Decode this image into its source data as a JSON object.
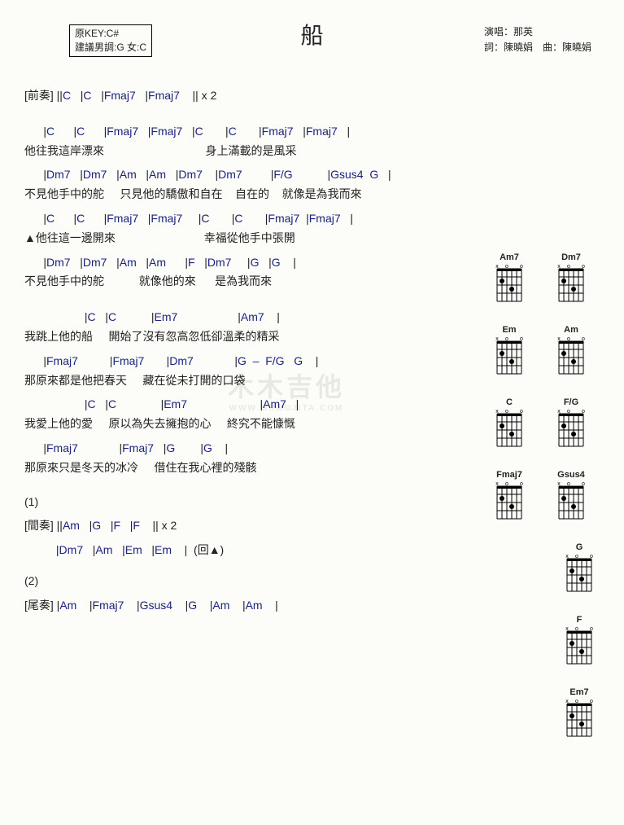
{
  "header": {
    "title": "船",
    "key_line1": "原KEY:C#",
    "key_line2": "建議男調:G 女:C",
    "credit_singer": "演唱：那英",
    "credit_writer": "詞：陳曉娟　曲：陳曉娟"
  },
  "section_labels": {
    "intro": "[前奏] ",
    "inter": "[間奏] ",
    "outro": "[尾奏] ",
    "one": "(1)",
    "two": "(2)",
    "da": "(回▲)"
  },
  "intro": {
    "chords": [
      "C",
      "C",
      "Fmaj7",
      "Fmaj7"
    ],
    "tail": "|| x 2"
  },
  "verse1": {
    "l1_chords": [
      "C",
      "C",
      "Fmaj7",
      "Fmaj7",
      "C",
      "C",
      "Fmaj7",
      "Fmaj7"
    ],
    "l1_lyrics": "他往我這岸漂來                                身上滿載的是風采",
    "l2_chords": [
      "Dm7",
      "Dm7",
      "Am",
      "Am",
      "Dm7",
      "Dm7",
      "F/G",
      "Gsus4  G"
    ],
    "l2_lyrics": "不見他手中的舵     只見他的驕傲和自在    自在的    就像是為我而來",
    "l3_chords": [
      "C",
      "C",
      "Fmaj7",
      "Fmaj7",
      "C",
      "C",
      "Fmaj7",
      "Fmaj7"
    ],
    "l3_lyrics": "▲他往這一邊開來                            幸福從他手中張開",
    "l4_chords": [
      "Dm7",
      "Dm7",
      "Am",
      "Am",
      "F",
      "Dm7",
      "G",
      "G"
    ],
    "l4_lyrics": "不見他手中的舵           就像他的來      是為我而來"
  },
  "chorus": {
    "l1_chords": [
      "C",
      "C",
      "Em7",
      "Am7"
    ],
    "l1_lyrics": "我跳上他的船     開始了沒有忽高忽低卻溫柔的精采",
    "l2_chords": [
      "Fmaj7",
      "Fmaj7",
      "Dm7",
      "G  –  F/G   G"
    ],
    "l2_lyrics": "那原來都是他把春天     藏在從未打開的口袋",
    "l3_chords": [
      "C",
      "C",
      "Em7",
      "Am7"
    ],
    "l3_lyrics": "我愛上他的愛     原以為失去擁抱的心     終究不能慷慨",
    "l4_chords": [
      "Fmaj7",
      "Fmaj7",
      "G",
      "G"
    ],
    "l4_lyrics": "那原來只是冬天的冰冷     借住在我心裡的殘骸"
  },
  "interlude": {
    "l1_chords": [
      "Am",
      "G",
      "F",
      "F"
    ],
    "l1_tail": "|| x 2",
    "l2_chords": [
      "Dm7",
      "Am",
      "Em",
      "Em"
    ]
  },
  "outro": {
    "chords": [
      "Am",
      "Fmaj7",
      "Gsus4",
      "G",
      "Am",
      "Am"
    ]
  },
  "diagrams": [
    [
      "Am7",
      "Dm7"
    ],
    [
      "Em",
      "Am"
    ],
    [
      "C",
      "F/G"
    ],
    [
      "Fmaj7",
      "Gsus4"
    ],
    [
      "G"
    ],
    [
      "F"
    ],
    [
      "Em7"
    ]
  ],
  "watermark": {
    "main": "木木吉他",
    "sub": "WWW.MUMUJITA.COM"
  }
}
